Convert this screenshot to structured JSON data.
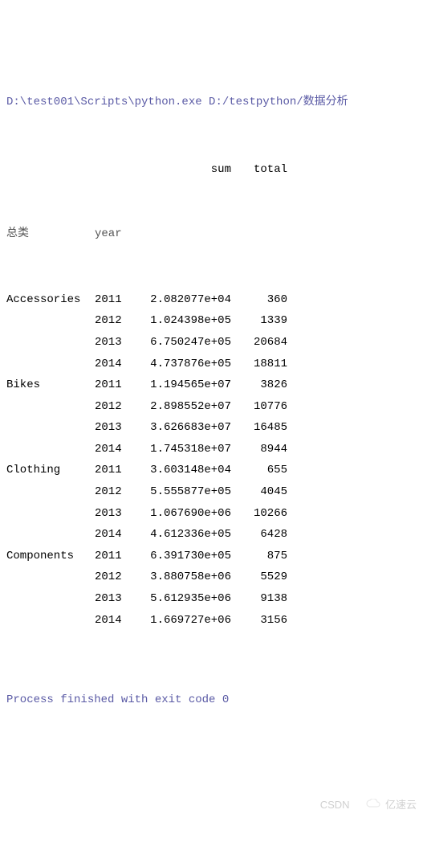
{
  "command_line": "D:\\test001\\Scripts\\python.exe D:/testpython/数据分析",
  "columns": {
    "sum": "sum",
    "total": "total"
  },
  "index_names": {
    "category": "总类",
    "year": "year"
  },
  "rows": [
    {
      "category": "Accessories",
      "year": "2011",
      "sum": "2.082077e+04",
      "total": "360"
    },
    {
      "category": "",
      "year": "2012",
      "sum": "1.024398e+05",
      "total": "1339"
    },
    {
      "category": "",
      "year": "2013",
      "sum": "6.750247e+05",
      "total": "20684"
    },
    {
      "category": "",
      "year": "2014",
      "sum": "4.737876e+05",
      "total": "18811"
    },
    {
      "category": "Bikes",
      "year": "2011",
      "sum": "1.194565e+07",
      "total": "3826"
    },
    {
      "category": "",
      "year": "2012",
      "sum": "2.898552e+07",
      "total": "10776"
    },
    {
      "category": "",
      "year": "2013",
      "sum": "3.626683e+07",
      "total": "16485"
    },
    {
      "category": "",
      "year": "2014",
      "sum": "1.745318e+07",
      "total": "8944"
    },
    {
      "category": "Clothing",
      "year": "2011",
      "sum": "3.603148e+04",
      "total": "655"
    },
    {
      "category": "",
      "year": "2012",
      "sum": "5.555877e+05",
      "total": "4045"
    },
    {
      "category": "",
      "year": "2013",
      "sum": "1.067690e+06",
      "total": "10266"
    },
    {
      "category": "",
      "year": "2014",
      "sum": "4.612336e+05",
      "total": "6428"
    },
    {
      "category": "Components",
      "year": "2011",
      "sum": "6.391730e+05",
      "total": "875"
    },
    {
      "category": "",
      "year": "2012",
      "sum": "3.880758e+06",
      "total": "5529"
    },
    {
      "category": "",
      "year": "2013",
      "sum": "5.612935e+06",
      "total": "9138"
    },
    {
      "category": "",
      "year": "2014",
      "sum": "1.669727e+06",
      "total": "3156"
    }
  ],
  "exit_message": "Process finished with exit code 0",
  "watermarks": {
    "csdn": "CSDN",
    "yisu": "亿速云"
  }
}
